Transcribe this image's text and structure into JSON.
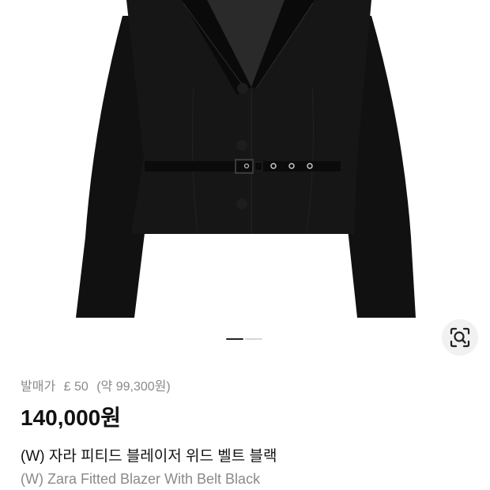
{
  "product": {
    "release_label": "발매가",
    "release_price": "£ 50",
    "release_converted": "(약 99,300원)",
    "price": "140,000원",
    "title_ko": "(W) 자라 피티드 블레이저 위드 벨트 블랙",
    "title_en": "(W) Zara Fitted Blazer With Belt Black"
  },
  "gallery": {
    "image_subject": "black-fitted-blazer-with-belt",
    "pager": {
      "count": 2,
      "active": 1
    },
    "lens_icon": "image-search-icon"
  },
  "colors": {
    "jacket": "#111111",
    "price_text": "#111111",
    "muted_text": "#8a8a8a",
    "lens_bg": "#f1f1f1"
  }
}
